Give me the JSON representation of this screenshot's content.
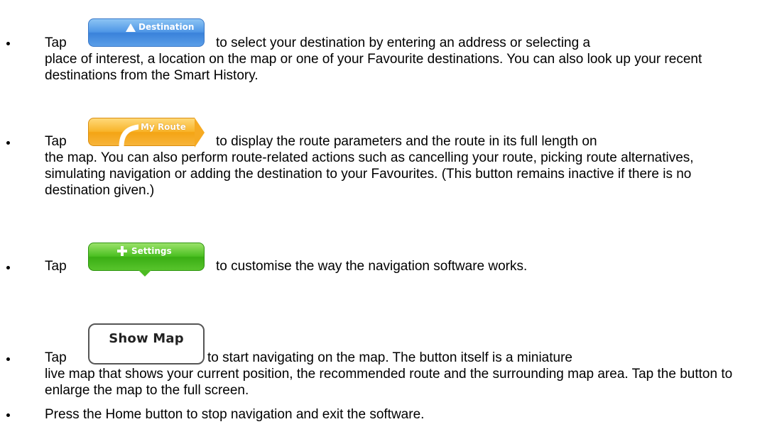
{
  "items": [
    {
      "tap": "Tap",
      "button_label": "Destination",
      "line1": "to select your destination by entering an address or selecting a",
      "rest": "place of interest, a location on the map or one of your Favourite destinations. You can also look up your recent destinations from the Smart History."
    },
    {
      "tap": "Tap",
      "button_label": "My Route",
      "line1": "to display the route parameters and the route in its full length on",
      "rest": "the map. You can also perform route-related actions such as cancelling your route, picking route alternatives, simulating navigation or adding the destination to your Favourites. (This button remains inactive if there is no destination given.)"
    },
    {
      "tap": "Tap",
      "button_label": "Settings",
      "line1": "to customise the way the navigation software works."
    },
    {
      "tap": "Tap",
      "button_label": "Show Map",
      "line1": "to start navigating on the map. The button itself is a miniature",
      "rest": "live map that shows your current position, the recommended route and the surrounding map area. Tap the button to enlarge the map to the full screen."
    },
    {
      "text": "Press the Home button to stop navigation and exit the software."
    }
  ],
  "colors": {
    "destination": "#4e96e6",
    "my_route": "#f8b52b",
    "settings": "#4cc022",
    "show_map_border": "#555555"
  }
}
